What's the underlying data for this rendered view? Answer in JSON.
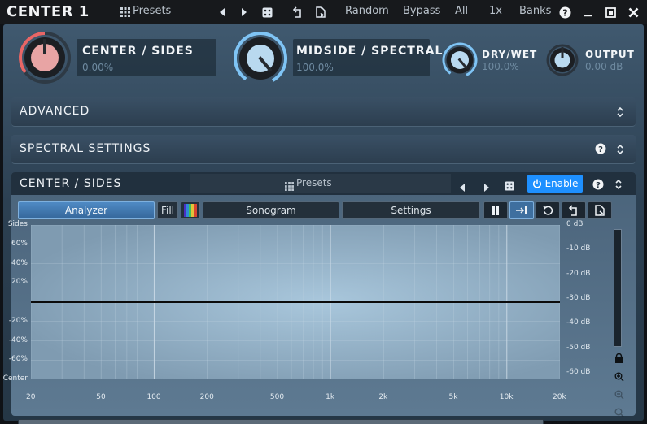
{
  "app": {
    "title": "CENTER 1",
    "presets_label": "Presets",
    "random_label": "Random",
    "bypass_label": "Bypass",
    "all_label": "All",
    "zoom_label": "1x",
    "banks_label": "Banks"
  },
  "knobs": {
    "center_sides": {
      "label": "CENTER / SIDES",
      "value": "0.00%"
    },
    "midside_spectral": {
      "label": "MIDSIDE / SPECTRAL",
      "value": "100.0%"
    },
    "dry_wet": {
      "label": "DRY/WET",
      "value": "100.0%"
    },
    "output": {
      "label": "OUTPUT",
      "value": "0.00 dB"
    }
  },
  "sections": {
    "advanced": "ADVANCED",
    "spectral_settings": "SPECTRAL SETTINGS"
  },
  "panel": {
    "title": "CENTER / SIDES",
    "presets_label": "Presets",
    "enable_label": "Enable",
    "buttons": {
      "analyzer": "Analyzer",
      "fill": "Fill",
      "sonogram": "Sonogram",
      "settings": "Settings"
    }
  },
  "chart_data": {
    "type": "line",
    "x_scale": "log",
    "xlim": [
      20,
      20000
    ],
    "x_ticks": [
      "20",
      "50",
      "100",
      "200",
      "500",
      "1k",
      "2k",
      "5k",
      "10k",
      "20k"
    ],
    "y_ticks_left": [
      "Sides",
      "60%",
      "40%",
      "20%",
      "",
      "-20%",
      "-40%",
      "-60%",
      "Center"
    ],
    "y_ticks_right": [
      "0 dB",
      "-10 dB",
      "-20 dB",
      "-30 dB",
      "-40 dB",
      "-50 dB",
      "-60 dB"
    ],
    "ylim": [
      -100,
      100
    ],
    "grid": true,
    "series": [
      {
        "x": [
          20,
          20000
        ],
        "y": [
          0,
          0
        ]
      }
    ]
  },
  "colors": {
    "accent_blue": "#1e90ff",
    "knob_red_ring": "#e86666",
    "knob_blue_ring": "#7fc4f5",
    "curve": "#0b0b0b"
  }
}
